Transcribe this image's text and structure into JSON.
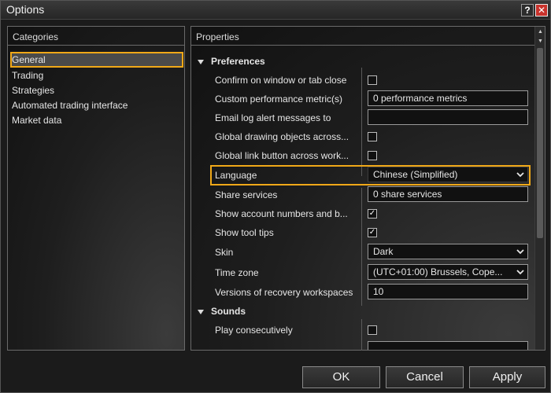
{
  "window": {
    "title": "Options",
    "help_label": "?",
    "close_label": "✕"
  },
  "categories": {
    "header": "Categories",
    "items": [
      {
        "label": "General",
        "selected": true
      },
      {
        "label": "Trading"
      },
      {
        "label": "Strategies"
      },
      {
        "label": "Automated trading interface"
      },
      {
        "label": "Market data"
      }
    ]
  },
  "properties": {
    "header": "Properties",
    "sections": [
      {
        "label": "Preferences"
      },
      {
        "label": "Sounds"
      }
    ],
    "rows": [
      {
        "label": "Confirm on window or tab close",
        "type": "checkbox",
        "checked": false
      },
      {
        "label": "Custom performance metric(s)",
        "type": "text",
        "value": "0 performance metrics"
      },
      {
        "label": "Email log alert messages to",
        "type": "text",
        "value": ""
      },
      {
        "label": "Global drawing objects across...",
        "type": "checkbox",
        "checked": false
      },
      {
        "label": "Global link button across work...",
        "type": "checkbox",
        "checked": false
      },
      {
        "label": "Language",
        "type": "select",
        "value": "Chinese (Simplified)",
        "highlighted": true
      },
      {
        "label": "Share services",
        "type": "text",
        "value": "0 share services"
      },
      {
        "label": "Show account numbers and b...",
        "type": "checkbox",
        "checked": true
      },
      {
        "label": "Show tool tips",
        "type": "checkbox",
        "checked": true
      },
      {
        "label": "Skin",
        "type": "select",
        "value": "Dark"
      },
      {
        "label": "Time zone",
        "type": "select",
        "value": "(UTC+01:00) Brussels, Cope..."
      },
      {
        "label": "Versions of recovery workspaces",
        "type": "text",
        "value": "10"
      },
      {
        "label": "Play consecutively",
        "type": "checkbox",
        "checked": false
      }
    ]
  },
  "footer": {
    "ok_label": "OK",
    "cancel_label": "Cancel",
    "apply_label": "Apply"
  },
  "colors": {
    "highlight": "#f0a818",
    "background": "#1b1b1b",
    "close_button": "#c8322c"
  }
}
